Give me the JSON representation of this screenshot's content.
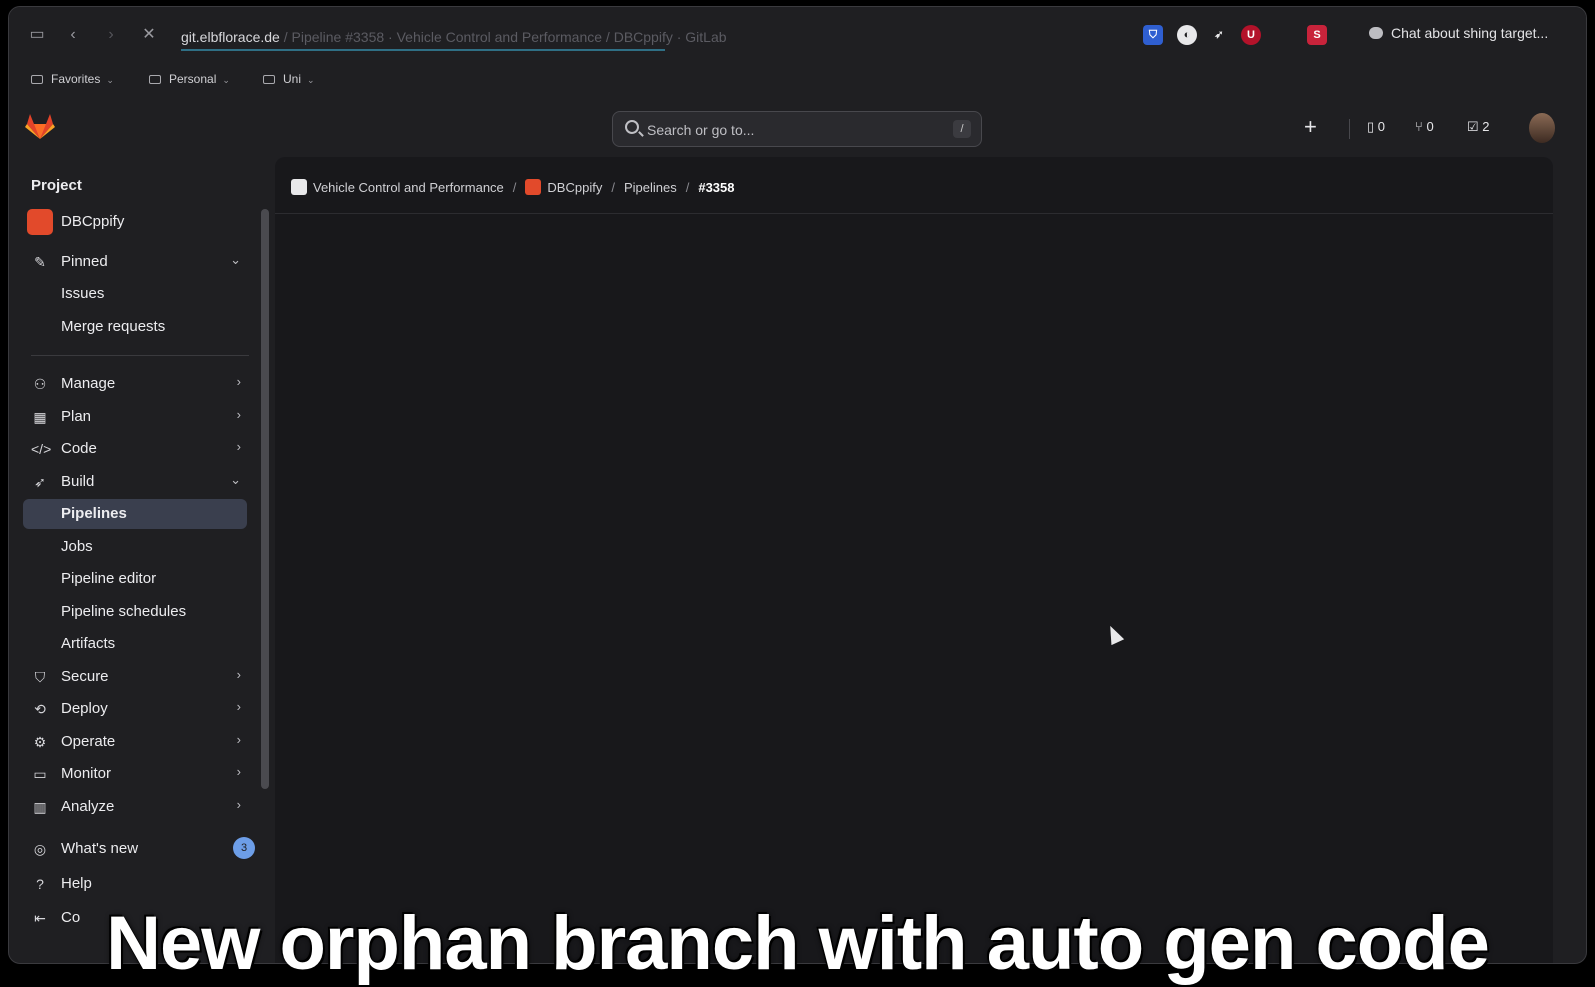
{
  "browser": {
    "url_host": "git.elbflorace.de",
    "url_rest": " / Pipeline #3358 · Vehicle Control and Performance / DBCppify · GitLab",
    "chat_label": "Chat about shing target...",
    "bookmarks": [
      "Favorites",
      "Personal",
      "Uni"
    ]
  },
  "topbar": {
    "search_placeholder": "Search or go to...",
    "search_shortcut": "/",
    "issues_count": "0",
    "mr_count": "0",
    "todo_count": "2"
  },
  "sidebar": {
    "heading": "Project",
    "project_name": "DBCppify",
    "pinned": "Pinned",
    "pinned_items": [
      "Issues",
      "Merge requests"
    ],
    "sections": [
      "Manage",
      "Plan",
      "Code",
      "Build"
    ],
    "build_items": [
      "Pipelines",
      "Jobs",
      "Pipeline editor",
      "Pipeline schedules",
      "Artifacts"
    ],
    "more_sections": [
      "Secure",
      "Deploy",
      "Operate",
      "Monitor",
      "Analyze"
    ],
    "whats_new": "What's new",
    "whats_new_badge": "3",
    "help": "Help",
    "collapse": "Co"
  },
  "breadcrumb": {
    "group": "Vehicle Control and Performance",
    "project": "DBCppify",
    "section": "Pipelines",
    "current": "#3358"
  },
  "caption": "New orphan branch with auto gen code"
}
